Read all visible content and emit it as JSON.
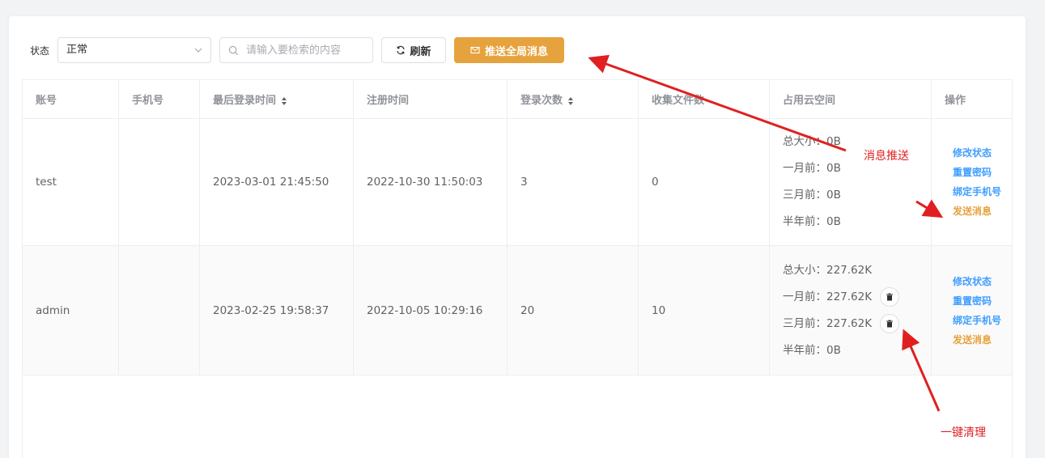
{
  "toolbar": {
    "status_label": "状态",
    "status_value": "正常",
    "search_placeholder": "请输入要检索的内容",
    "refresh_label": "刷新",
    "push_label": "推送全局消息"
  },
  "table": {
    "headers": [
      "账号",
      "手机号",
      "最后登录时间",
      "注册时间",
      "登录次数",
      "收集文件数",
      "占用云空间",
      "操作"
    ],
    "rows": [
      {
        "account": "test",
        "phone": "",
        "last_login": "2023-03-01 21:45:50",
        "registered": "2022-10-30 11:50:03",
        "login_count": "3",
        "file_count": "0",
        "space": {
          "total": "总大小：0B",
          "month1": "一月前：0B",
          "month3": "三月前：0B",
          "month6": "半年前：0B"
        }
      },
      {
        "account": "admin",
        "phone": "",
        "last_login": "2023-02-25 19:58:37",
        "registered": "2022-10-05 10:29:16",
        "login_count": "20",
        "file_count": "10",
        "space": {
          "total": "总大小：227.62K",
          "month1": "一月前：227.62K",
          "month3": "三月前：227.62K",
          "month6": "半年前：0B"
        }
      }
    ],
    "actions": {
      "modify_status": "修改状态",
      "reset_password": "重置密码",
      "bind_phone": "绑定手机号",
      "send_message": "发送消息"
    }
  },
  "annotations": {
    "push": "消息推送",
    "clean": "一键清理"
  },
  "colors": {
    "warning": "#e6a23c",
    "primary": "#409eff",
    "annotation": "#e02020"
  }
}
